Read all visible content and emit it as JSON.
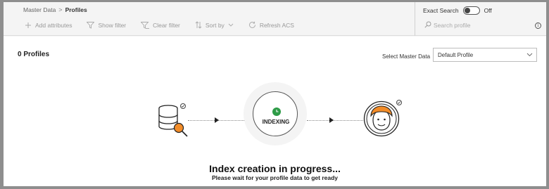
{
  "breadcrumb": {
    "parent": "Master Data",
    "separator": ">",
    "current": "Profiles"
  },
  "exact_search": {
    "label": "Exact Search",
    "state": "Off"
  },
  "toolbar": {
    "add_attributes": "Add attributes",
    "show_filter": "Show filter",
    "clear_filter": "Clear filter",
    "sort_by": "Sort by",
    "refresh_acs": "Refresh ACS"
  },
  "search": {
    "placeholder": "Search profile"
  },
  "info_icon": "i",
  "profiles_count": "0 Profiles",
  "master_data": {
    "label": "Select Master Data",
    "selected": "Default Profile"
  },
  "indexing_label": "INDEXING",
  "status": {
    "title": "Index creation in progress...",
    "subtitle": "Please wait for your profile data to get ready"
  },
  "colors": {
    "accent_green": "#2e9b47",
    "accent_orange": "#f28c28"
  },
  "icons": [
    "plus-icon",
    "filter-icon",
    "clear-filter-icon",
    "sort-icon",
    "chevron-down-icon",
    "refresh-icon",
    "search-icon",
    "info-icon",
    "database-search-icon",
    "clock-icon",
    "user-face-icon",
    "check-icon"
  ]
}
